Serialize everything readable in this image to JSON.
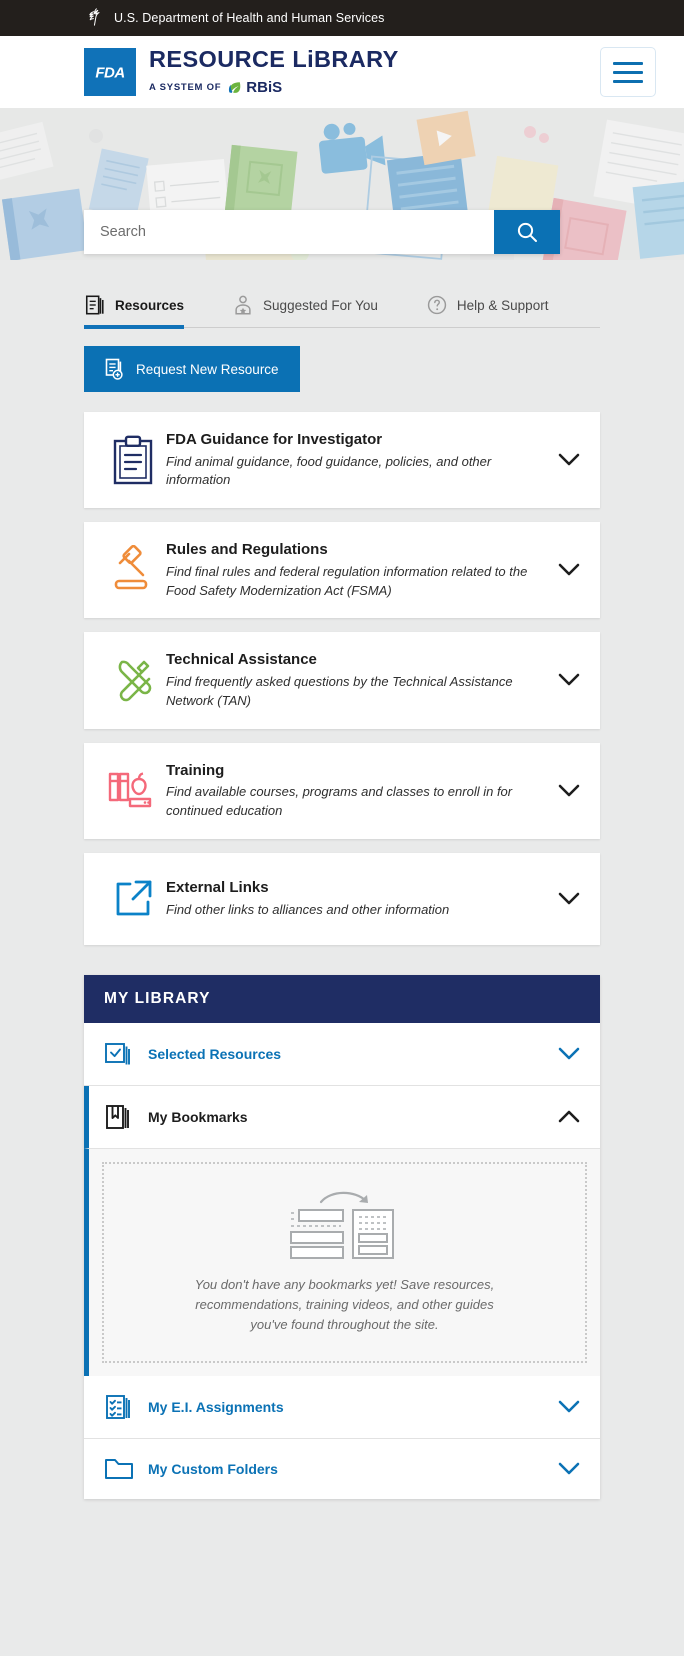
{
  "gov_banner": {
    "text": "U.S. Department of Health and Human Services",
    "logo_icon": "hhs-seal-icon"
  },
  "header": {
    "agency_mark": "FDA",
    "title": "RESOURCE LiBRARY",
    "subtitle_prefix": "A SYSTEM OF",
    "subtitle_brand": "RBiS",
    "menu_icon": "hamburger-menu-icon",
    "accent_blue": "#1072b8",
    "navy": "#1b2a62",
    "green": "#6cb43f"
  },
  "search": {
    "placeholder": "Search",
    "value": "",
    "button_icon": "search-icon",
    "button_color": "#0b71b4"
  },
  "tabs": [
    {
      "label": "Resources",
      "icon": "documents-icon",
      "active": true
    },
    {
      "label": "Suggested For You",
      "icon": "user-badge-icon",
      "active": false
    },
    {
      "label": "Help & Support",
      "icon": "question-mark-circle-icon",
      "active": false
    }
  ],
  "request_button": {
    "label": "Request New Resource",
    "icon": "document-plus-icon",
    "color": "#0b71b4"
  },
  "resources": [
    {
      "title": "FDA Guidance for Investigator",
      "description": "Find animal guidance, food guidance, policies, and other information",
      "icon": "clipboard-icon",
      "icon_color": "#1f2d64",
      "chevron": "chevron-down-icon"
    },
    {
      "title": "Rules and Regulations",
      "description": "Find final rules and federal regulation information related to the Food Safety Modernization Act (FSMA)",
      "icon": "gavel-icon",
      "icon_color": "#ef8c3a",
      "chevron": "chevron-down-icon"
    },
    {
      "title": "Technical Assistance",
      "description": "Find frequently asked questions by the Technical Assistance Network (TAN)",
      "icon": "wrench-screwdriver-icon",
      "icon_color": "#7ab547",
      "chevron": "chevron-down-icon"
    },
    {
      "title": "Training",
      "description": "Find available courses, programs and classes to enroll in for continued education",
      "icon": "books-apple-icon",
      "icon_color": "#f4697a",
      "chevron": "chevron-down-icon"
    },
    {
      "title": "External Links",
      "description": "Find other links to alliances and other information",
      "icon": "external-link-icon",
      "icon_color": "#0b82c8",
      "chevron": "chevron-down-icon"
    }
  ],
  "my_library": {
    "heading": "MY LIBRARY",
    "heading_bg": "#1f2d64",
    "rows": [
      {
        "label": "Selected Resources",
        "icon": "checked-stack-icon",
        "expanded": false,
        "chevron": "chevron-down-icon"
      },
      {
        "label": "My Bookmarks",
        "icon": "bookmark-icon",
        "expanded": true,
        "chevron": "chevron-up-icon"
      },
      {
        "label": "My E.I. Assignments",
        "icon": "checklist-icon",
        "expanded": false,
        "chevron": "chevron-down-icon"
      },
      {
        "label": "My Custom Folders",
        "icon": "folder-icon",
        "expanded": false,
        "chevron": "chevron-down-icon"
      }
    ],
    "bookmarks_empty": {
      "illustration": "drag-to-save-illustration",
      "message": "You don't have any bookmarks yet! Save resources, recommendations, training videos, and other guides you've found throughout the site."
    }
  }
}
